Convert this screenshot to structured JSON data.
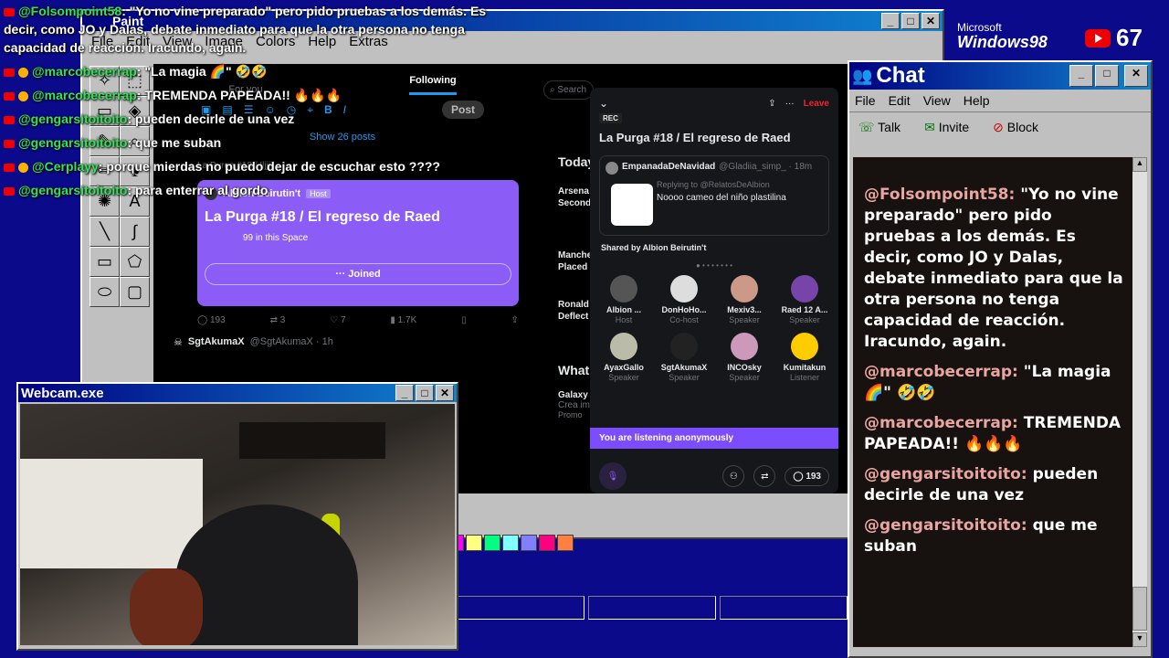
{
  "overlay_chat": [
    {
      "user": "@Folsompoint58",
      "text": ": \"Yo no vine preparado\" pero pido pruebas a los demás. Es",
      "badge": "yt"
    },
    {
      "user": "",
      "text": "decir, como JO y Dalas, debate inmediato para que la otra persona no tenga",
      "badge": ""
    },
    {
      "user": "",
      "text": "capacidad de reacción. Iracundo, again.",
      "badge": ""
    },
    {
      "user": "@marcobecerrap",
      "text": ": \"La magia 🌈\" 🤣🤣",
      "badge": "yt-star"
    },
    {
      "user": "@marcobecerrap",
      "text": ": TREMENDA PAPEADA!! 🔥🔥🔥",
      "badge": "yt-star"
    },
    {
      "user": "@gengarsitoitoito",
      "text": ": pueden decirle de una vez",
      "badge": "yt"
    },
    {
      "user": "@gengarsitoitoito",
      "text": ": que me suban",
      "badge": "yt"
    },
    {
      "user": "@Cerplayy",
      "text": ": porque mierdas no puedo dejar de escuchar esto ????",
      "badge": "yt-star"
    },
    {
      "user": "@gengarsitoitoito",
      "text": ": para enterrar al gordo",
      "badge": "yt"
    }
  ],
  "branding": {
    "os_line1": "Microsoft",
    "os_line2": "Windows98",
    "viewer_count": "67"
  },
  "paint": {
    "title": "Paint",
    "menu": [
      "File",
      "Edit",
      "View",
      "Image",
      "Colors",
      "Help",
      "Extras"
    ],
    "palette": [
      "#ffff00",
      "#00ff00",
      "#00ffff",
      "#0000ff",
      "#ff00ff",
      "#ffff80",
      "#00ff80",
      "#80ffff",
      "#8080ff",
      "#ff0080",
      "#ff8040"
    ]
  },
  "feed": {
    "tab_for_you": "For you",
    "tab_following": "Following",
    "post_button": "Post",
    "show_posts": "Show 26 posts",
    "retweet_line": "La Purga #18 / Iljjiji",
    "space_card": {
      "host": "Albion Beirutin't",
      "host_badge": "Host",
      "title": "La Purga #18 / El regreso de Raed",
      "listeners": "99 in this Space",
      "joined": "Joined"
    },
    "stats": {
      "replies": "193",
      "retweets": "3",
      "likes": "7",
      "views": "1.7K"
    },
    "next_user": "SgtAkumaX",
    "next_handle": "@SgtAkumaX · 1h"
  },
  "right_column": {
    "search": "Search",
    "today": "Today",
    "items": [
      "Arsena",
      "Second",
      "Manche",
      "Placed",
      "Ronald",
      "Deflect"
    ],
    "what": "What",
    "galaxy": "Galaxy",
    "crea": "Crea im",
    "promo": "Promo"
  },
  "space_panel": {
    "leave": "Leave",
    "rec": "REC",
    "title": "La Purga #18 / El regreso de Raed",
    "pinned_user": "EmpanadaDeNavidad",
    "pinned_handle": "@Gladiia_simp_ · 18m",
    "replying_to": "Replying to @RelatosDeAlbion",
    "pinned_text": "Noooo cameo del niño plastilina",
    "shared_by": "Shared by Albion Beirutin't",
    "speakers": [
      {
        "name": "Albion ...",
        "role": "Host",
        "color": "#555"
      },
      {
        "name": "DonHoHo...",
        "role": "Co-host",
        "color": "#ddd"
      },
      {
        "name": "Mexiv3...",
        "role": "Speaker",
        "color": "#c98"
      },
      {
        "name": "Raed 12 A...",
        "role": "Speaker",
        "color": "#74a"
      },
      {
        "name": "AyaxGallo",
        "role": "Speaker",
        "color": "#bba"
      },
      {
        "name": "SgtAkumaX",
        "role": "Speaker",
        "color": "#222"
      },
      {
        "name": "INCOsky",
        "role": "Speaker",
        "color": "#c9b"
      },
      {
        "name": "Kumitakun",
        "role": "Listener",
        "color": "#fc0"
      }
    ],
    "listening_banner": "You are listening anonymously",
    "comment_count": "193"
  },
  "chat_window": {
    "title": "Chat",
    "menu": [
      "File",
      "Edit",
      "View",
      "Help"
    ],
    "toolbar": [
      "Talk",
      "Invite",
      "Block"
    ],
    "messages": [
      {
        "user": "@Folsompoint58:",
        "text": "\"Yo no vine preparado\" pero pido pruebas a los demás. Es decir, como JO y Dalas, debate inmediato para que la otra persona no tenga capacidad de reacción. Iracundo, again."
      },
      {
        "user": "@marcobecerrap:",
        "text": "\"La magia 🌈\" 🤣🤣"
      },
      {
        "user": "@marcobecerrap:",
        "text": "TREMENDA PAPEADA!! 🔥🔥🔥"
      },
      {
        "user": "@gengarsitoitoito:",
        "text": "pueden decirle de una vez"
      },
      {
        "user": "@gengarsitoitoito:",
        "text": "que me suban"
      }
    ]
  },
  "webcam": {
    "title": "Webcam.exe"
  }
}
